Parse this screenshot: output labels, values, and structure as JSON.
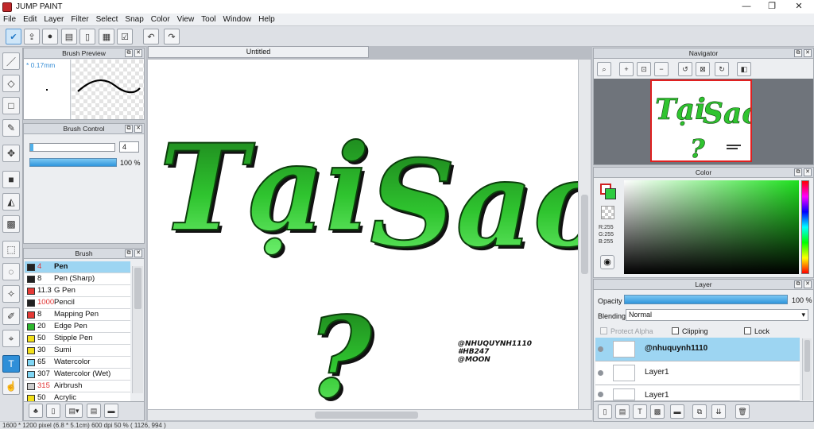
{
  "app": {
    "title": "JUMP PAINT"
  },
  "window_controls": {
    "minimize": "—",
    "maximize": "❐",
    "close": "✕"
  },
  "menu": [
    "File",
    "Edit",
    "Layer",
    "Filter",
    "Select",
    "Snap",
    "Color",
    "View",
    "Tool",
    "Window",
    "Help"
  ],
  "toolbar_icons": [
    "check-icon",
    "export-icon",
    "comment-icon",
    "balloon-icon",
    "page-icon",
    "panel-icon",
    "checklist-icon",
    "undo-icon",
    "redo-icon"
  ],
  "left_tools": [
    "brush-icon",
    "eraser-icon",
    "rect-select-icon",
    "pen-icon",
    "move-icon",
    "fill-rect-icon",
    "bucket-icon",
    "gradient-icon",
    "marquee-icon",
    "lasso-icon",
    "magic-wand-icon",
    "edit-icon",
    "select-pen-icon",
    "text-icon",
    "hand-icon"
  ],
  "brush_preview": {
    "title": "Brush Preview",
    "size_label": "* 0.17mm"
  },
  "brush_control": {
    "title": "Brush Control",
    "size_value": "4",
    "opacity_value": "100 %"
  },
  "brush": {
    "title": "Brush",
    "items": [
      {
        "size": "4",
        "name": "Pen",
        "color": "#222222",
        "size_color": "#e03030",
        "selected": true
      },
      {
        "size": "8",
        "name": "Pen (Sharp)",
        "color": "#222222",
        "size_color": "#111111",
        "selected": false
      },
      {
        "size": "11.3",
        "name": "G Pen",
        "color": "#e53935",
        "size_color": "#111111",
        "selected": false
      },
      {
        "size": "1000",
        "name": "Pencil",
        "color": "#222222",
        "size_color": "#e03030",
        "selected": false
      },
      {
        "size": "8",
        "name": "Mapping Pen",
        "color": "#e53935",
        "size_color": "#111111",
        "selected": false
      },
      {
        "size": "20",
        "name": "Edge Pen",
        "color": "#2eb82e",
        "size_color": "#111111",
        "selected": false
      },
      {
        "size": "50",
        "name": "Stipple Pen",
        "color": "#f2e01a",
        "size_color": "#111111",
        "selected": false
      },
      {
        "size": "30",
        "name": "Sumi",
        "color": "#f2e01a",
        "size_color": "#111111",
        "selected": false
      },
      {
        "size": "65",
        "name": "Watercolor",
        "color": "#7fd6f5",
        "size_color": "#111111",
        "selected": false
      },
      {
        "size": "307",
        "name": "Watercolor (Wet)",
        "color": "#7fd6f5",
        "size_color": "#111111",
        "selected": false
      },
      {
        "size": "315",
        "name": "Airbrush",
        "color": "#cccccc",
        "size_color": "#e03030",
        "selected": false
      },
      {
        "size": "50",
        "name": "Acrylic",
        "color": "#f2e01a",
        "size_color": "#111111",
        "selected": false
      }
    ]
  },
  "canvas": {
    "tab_title": "Untitled",
    "artwork_text": {
      "line1": "Tại",
      "line2": "Sao",
      "line3": "?"
    },
    "credits": [
      "@NHUQUYNH1110",
      "#HB247",
      "@MOON"
    ]
  },
  "navigator": {
    "title": "Navigator"
  },
  "color": {
    "title": "Color",
    "r": "R:255",
    "g": "G:255",
    "b": "B:255",
    "primary": "#ffffff",
    "secondary": "#2ecc40"
  },
  "layer": {
    "title": "Layer",
    "opacity_label": "Opacity",
    "opacity_value": "100 %",
    "blending_label": "Blending",
    "blending_value": "Normal",
    "protect_alpha": "Protect Alpha",
    "clipping": "Clipping",
    "lock": "Lock",
    "layers": [
      {
        "name": "@nhuquynh1110",
        "selected": true
      },
      {
        "name": "Layer1",
        "selected": false
      },
      {
        "name": "Layer1",
        "selected": false
      }
    ]
  },
  "status": {
    "text": "1600 * 1200 pixel   (6.8 * 5.1cm)   600 dpi   50 %   ( 1126, 994 )"
  }
}
